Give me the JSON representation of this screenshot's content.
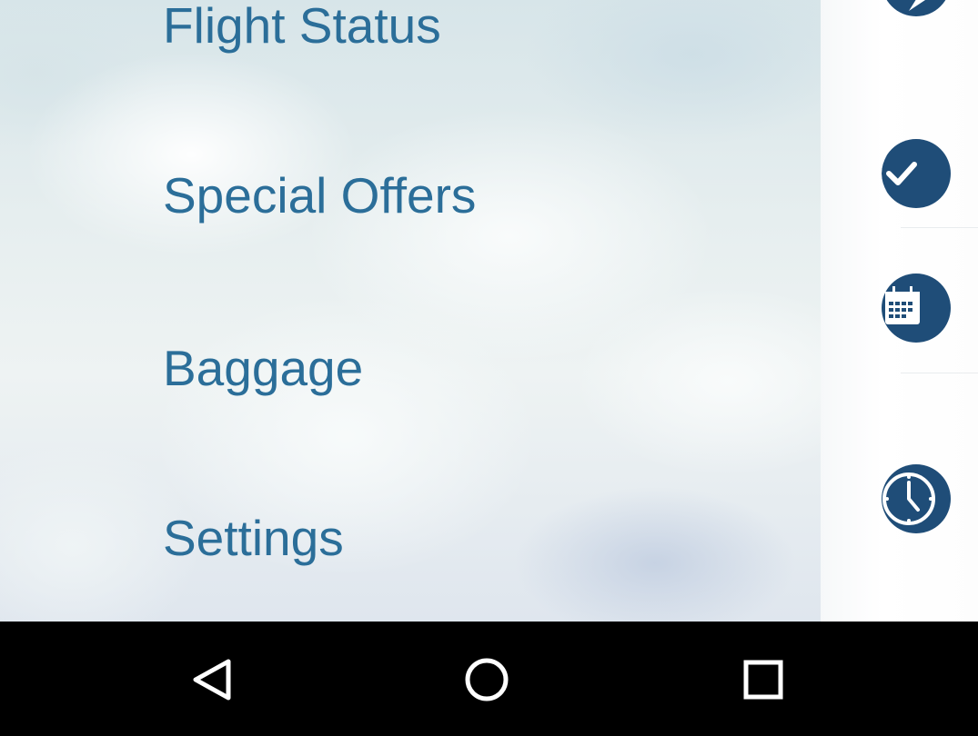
{
  "drawer": {
    "menu_items": [
      {
        "label": "Flight Status"
      },
      {
        "label": "Special Offers"
      },
      {
        "label": "Baggage"
      },
      {
        "label": "Settings"
      }
    ]
  },
  "underlay": {
    "icons": [
      "location-pin-icon",
      "check-icon",
      "calendar-icon",
      "clock-icon"
    ]
  },
  "navbar": {
    "buttons": [
      "back-icon",
      "home-icon",
      "recents-icon"
    ]
  },
  "colors": {
    "menu_text": "#2b6e99",
    "icon_fill": "#1f4d78",
    "navbar_bg": "#000000"
  }
}
